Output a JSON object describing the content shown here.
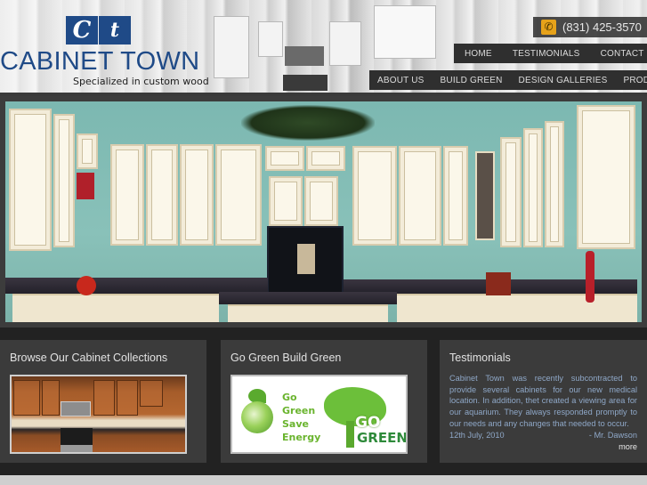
{
  "brand": {
    "logo_letters": [
      "C",
      "t"
    ],
    "name": "CABINET TOWN",
    "tagline": "Specialized in custom wood",
    "color": "#1f4a87"
  },
  "contact": {
    "icon": "phone-icon",
    "phone": "(831) 425-3570",
    "icon_color": "#e6a21a"
  },
  "nav": {
    "primary": [
      {
        "label": "HOME"
      },
      {
        "label": "TESTIMONIALS"
      },
      {
        "label": "CONTACT US"
      }
    ],
    "secondary": [
      {
        "label": "ABOUT US"
      },
      {
        "label": "BUILD GREEN"
      },
      {
        "label": "DESIGN GALLERIES"
      },
      {
        "label": "PRODUCTS"
      }
    ]
  },
  "hero": {
    "image": "white-kitchen-cabinets-photo"
  },
  "panels": [
    {
      "title": "Browse Our Cabinet Collections",
      "image": "wood-kitchen-cabinets-photo"
    },
    {
      "title": "Go Green Build Green",
      "image": "go-green-banner",
      "banner_text": [
        "Go",
        "Green",
        "Save",
        "Energy"
      ],
      "banner_logo_top": "GO",
      "banner_logo_bottom": "GREEN"
    },
    {
      "title": "Testimonials",
      "quote": "Cabinet Town was recently subcontracted to provide several cabinets for our new medical location. In addition, thet created a viewing area for our aquarium. They always responded promptly to our needs and any changes that needed to occur.",
      "date": "12th July, 2010",
      "author": "- Mr. Dawson",
      "more_label": "more"
    }
  ]
}
